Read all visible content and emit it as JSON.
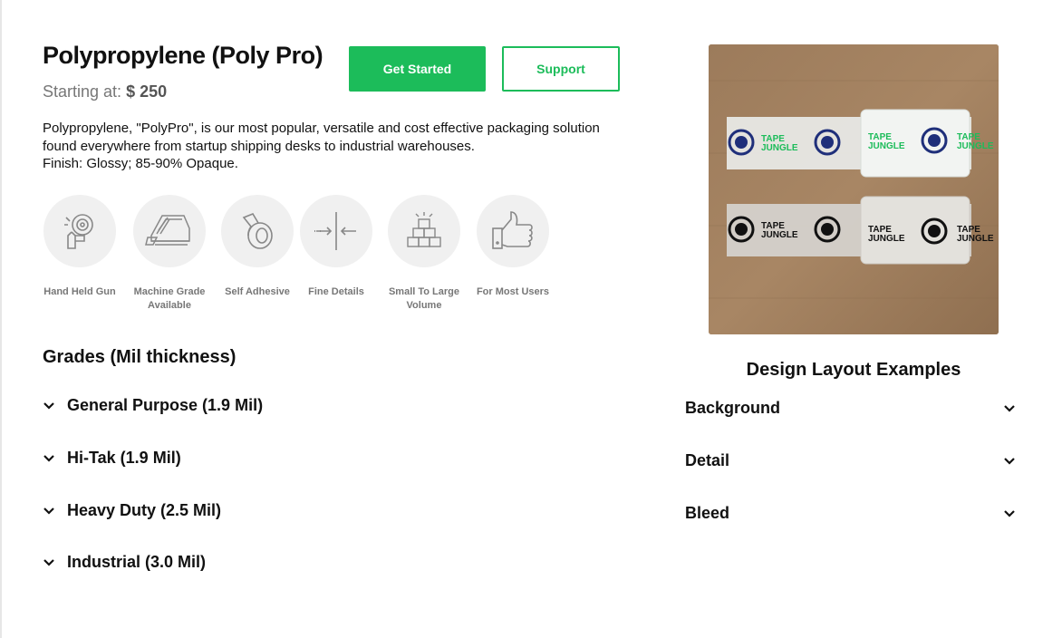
{
  "product": {
    "title": "Polypropylene (Poly Pro)",
    "price_label": "Starting at:",
    "price_value": "$ 250",
    "description_line1": "Polypropylene, \"PolyPro\", is our most popular, versatile and cost effective packaging solution",
    "description_line2": "found everywhere from startup shipping desks to industrial warehouses.",
    "description_line3": "Finish: Glossy; 85-90% Opaque."
  },
  "actions": {
    "get_started": "Get Started",
    "support": "Support"
  },
  "features": [
    {
      "label": "Hand Held Gun",
      "icon": "tape-gun-icon"
    },
    {
      "label": "Machine Grade Available",
      "icon": "tape-machine-icon"
    },
    {
      "label": "Self Adhesive",
      "icon": "tape-roll-icon"
    },
    {
      "label": "Fine Details",
      "icon": "fine-details-icon"
    },
    {
      "label": "Small To Large Volume",
      "icon": "boxes-icon"
    },
    {
      "label": "For Most Users",
      "icon": "thumbs-up-icon"
    }
  ],
  "grades": {
    "title": "Grades (Mil thickness)",
    "items": [
      {
        "label": "General Purpose (1.9 Mil)"
      },
      {
        "label": "Hi-Tak (1.9 Mil)"
      },
      {
        "label": "Heavy Duty (2.5 Mil)"
      },
      {
        "label": "Industrial (3.0 Mil)"
      }
    ]
  },
  "photo": {
    "brand_top": "TAPE",
    "brand_bottom": "JUNGLE"
  },
  "layout_examples": {
    "title": "Design Layout Examples",
    "items": [
      {
        "label": "Background"
      },
      {
        "label": "Detail"
      },
      {
        "label": "Bleed"
      }
    ]
  },
  "colors": {
    "accent": "#1cbc5a",
    "navy_logo": "#1f2f7a",
    "green_text": "#1cbc5a",
    "cardboard": "#a78563"
  }
}
